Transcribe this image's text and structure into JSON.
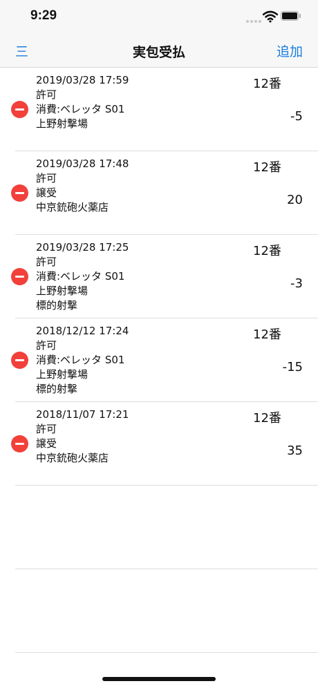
{
  "status_bar": {
    "time": "9:29"
  },
  "nav": {
    "menu_label": "三",
    "title": "実包受払",
    "add_label": "追加",
    "accent_color": "#1a7fe0"
  },
  "records": [
    {
      "datetime": "2019/03/28 17:59",
      "lines": [
        "許可",
        "消費:ベレッタ S01",
        "上野射撃場"
      ],
      "number": "12番",
      "amount": "-5"
    },
    {
      "datetime": "2019/03/28 17:48",
      "lines": [
        "許可",
        "譲受",
        "中京銃砲火薬店"
      ],
      "number": "12番",
      "amount": "20"
    },
    {
      "datetime": "2019/03/28 17:25",
      "lines": [
        "許可",
        "消費:ベレッタ S01",
        "上野射撃場",
        "標的射撃"
      ],
      "number": "12番",
      "amount": "-3"
    },
    {
      "datetime": "2018/12/12 17:24",
      "lines": [
        "許可",
        "消費:ベレッタ S01",
        "上野射撃場",
        "標的射撃"
      ],
      "number": "12番",
      "amount": "-15"
    },
    {
      "datetime": "2018/11/07 17:21",
      "lines": [
        "許可",
        "譲受",
        "中京銃砲火薬店"
      ],
      "number": "12番",
      "amount": "35"
    }
  ],
  "delete_color": "#f2403a",
  "icons": {
    "signal": "cellular-signal-icon",
    "wifi": "wifi-icon",
    "battery": "battery-icon",
    "delete": "minus-circle-icon"
  }
}
